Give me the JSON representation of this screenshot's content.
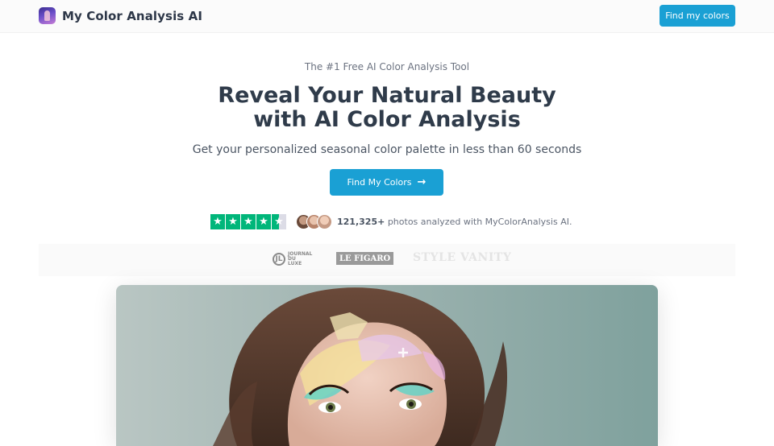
{
  "header": {
    "app_name": "My Color Analysis AI",
    "cta_label": "Find my colors"
  },
  "hero": {
    "eyebrow": "The #1 Free AI Color Analysis Tool",
    "headline_line1": "Reveal Your Natural Beauty",
    "headline_line2": "with AI Color Analysis",
    "subheadline": "Get your personalized seasonal color palette in less than 60 seconds",
    "cta_label": "Find My Colors",
    "cta_icon": "arrow-right-icon"
  },
  "social_proof": {
    "rating_stars": 4.5,
    "star_color": "#00b67a",
    "count": "121,325+",
    "text": "photos analyzed with MyColorAnalysis AI."
  },
  "press": {
    "logos": [
      {
        "name": "Journal du Luxe",
        "line1": "JOURNAL",
        "line2": "DU",
        "line3": "LUXE"
      },
      {
        "name": "Le Figaro",
        "text": "LE FIGARO"
      },
      {
        "name": "Style Vanity",
        "text": "STYLE VANITY"
      }
    ]
  },
  "theme": {
    "accent": "#1aa0d4",
    "text": "#2d3748"
  }
}
